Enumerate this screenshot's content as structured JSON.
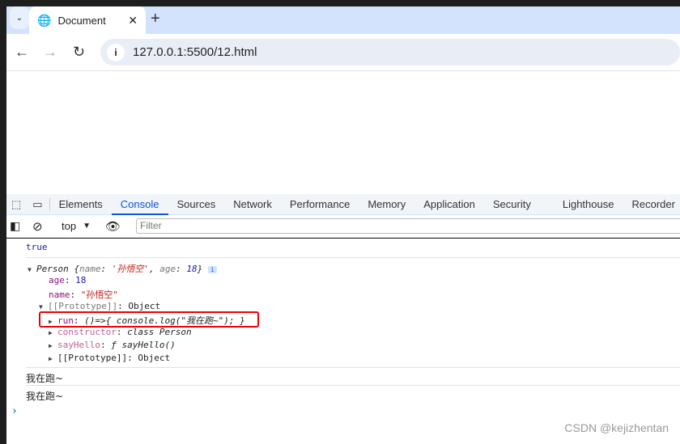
{
  "browser": {
    "tab_title": "Document",
    "url": "127.0.0.1:5500/12.html"
  },
  "devtools": {
    "tabs": [
      "Elements",
      "Console",
      "Sources",
      "Network",
      "Performance",
      "Memory",
      "Application",
      "Security",
      "Lighthouse",
      "Recorder"
    ],
    "active_tab": "Console",
    "context": "top",
    "filter_placeholder": "Filter"
  },
  "console": {
    "line_true": "true",
    "obj_header": {
      "cls": "Person",
      "preview_open": " {",
      "name_key": "name",
      "name_val": "'孙悟空'",
      "age_key": "age",
      "age_val": "18",
      "close": "}"
    },
    "age": {
      "key": "age",
      "val": "18"
    },
    "name": {
      "key": "name",
      "val": "\"孙悟空\""
    },
    "proto": {
      "key": "[[Prototype]]",
      "val": "Object"
    },
    "run": {
      "key": "run",
      "val": "()=>{ console.log(\"我在跑~\"); }"
    },
    "ctor": {
      "key": "constructor",
      "val": "class Person"
    },
    "say": {
      "key": "sayHello",
      "val": "ƒ sayHello()"
    },
    "proto2": {
      "key": "[[Prototype]]",
      "val": "Object"
    },
    "log1": "我在跑~",
    "log2": "我在跑~"
  },
  "watermark": "CSDN @kejizhentan",
  "colors": {
    "accent": "#0b57d0",
    "highlight_box": "#e00000"
  }
}
